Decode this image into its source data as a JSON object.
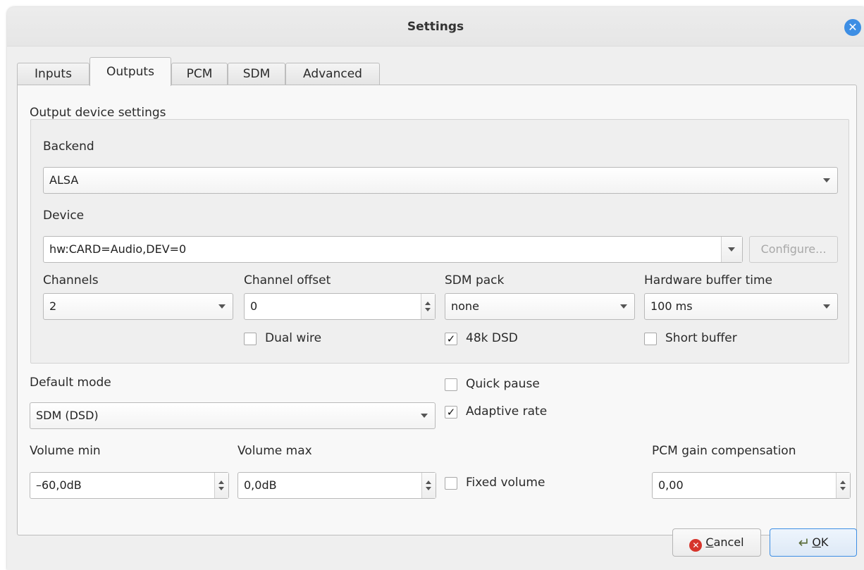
{
  "window": {
    "title": "Settings"
  },
  "tabs": [
    {
      "label": "Inputs"
    },
    {
      "label": "Outputs"
    },
    {
      "label": "PCM"
    },
    {
      "label": "SDM"
    },
    {
      "label": "Advanced"
    }
  ],
  "output_device": {
    "section_label": "Output device settings",
    "backend_label": "Backend",
    "backend_value": "ALSA",
    "device_label": "Device",
    "device_value": "hw:CARD=Audio,DEV=0",
    "configure_label": "Configure...",
    "channels_label": "Channels",
    "channels_value": "2",
    "channel_offset_label": "Channel offset",
    "channel_offset_value": "0",
    "sdm_pack_label": "SDM pack",
    "sdm_pack_value": "none",
    "hw_buffer_label": "Hardware buffer time",
    "hw_buffer_value": "100 ms",
    "dual_wire_label": "Dual wire",
    "dual_wire_checked": false,
    "dsd48k_label": "48k DSD",
    "dsd48k_checked": true,
    "short_buffer_label": "Short buffer",
    "short_buffer_checked": false
  },
  "mode": {
    "default_mode_label": "Default mode",
    "default_mode_value": "SDM (DSD)",
    "quick_pause_label": "Quick pause",
    "quick_pause_checked": false,
    "adaptive_rate_label": "Adaptive rate",
    "adaptive_rate_checked": true
  },
  "volume": {
    "min_label": "Volume min",
    "min_value": "–60,0dB",
    "max_label": "Volume max",
    "max_value": "0,0dB",
    "fixed_label": "Fixed volume",
    "fixed_checked": false,
    "pcm_gain_label": "PCM gain compensation",
    "pcm_gain_value": "0,00"
  },
  "footer": {
    "cancel_prefix": "",
    "cancel_mnemonic": "C",
    "cancel_rest": "ancel",
    "ok_mnemonic": "O",
    "ok_rest": "K"
  },
  "icons": {
    "close": "close-icon",
    "cancel": "cancel-icon",
    "ok": "ok-icon"
  },
  "colors": {
    "accent": "#3d8ee4",
    "cancel_red": "#d6342b"
  }
}
